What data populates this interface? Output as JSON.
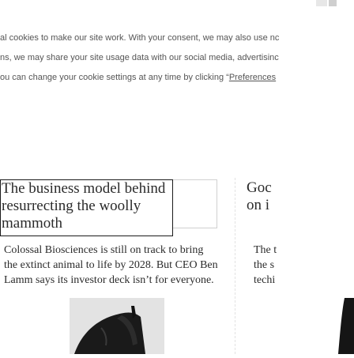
{
  "cookie_notice": {
    "line1": "al cookies to make our site work. With your consent, we may also use nc",
    "line2": "ns, we may share your site usage data with our social media, advertisinc",
    "line3_prefix": "ou can change your cookie settings at any time by clicking “",
    "line3_link": "Preferences"
  },
  "main_story": {
    "headline_line1": "The business model behind",
    "headline_line2": "resurrecting the woolly",
    "headline_line3": "mammoth",
    "summary_line1": "Colossal Biosciences is still on track to bring",
    "summary_line2": "the extinct animal to life by 2028. But CEO Ben",
    "summary_line3": "Lamm says its investor deck isn’t for everyone."
  },
  "side_story": {
    "headline_line1": "Goc",
    "headline_line2": "on i",
    "summary_line1": "The t",
    "summary_line2": "the s",
    "summary_line3": "techi"
  },
  "colors": {
    "text": "#2b2b2b",
    "cookie_text": "#555555",
    "thumb_bg": "#e3e3e3",
    "thumb_figure": "#1a1a1a"
  }
}
